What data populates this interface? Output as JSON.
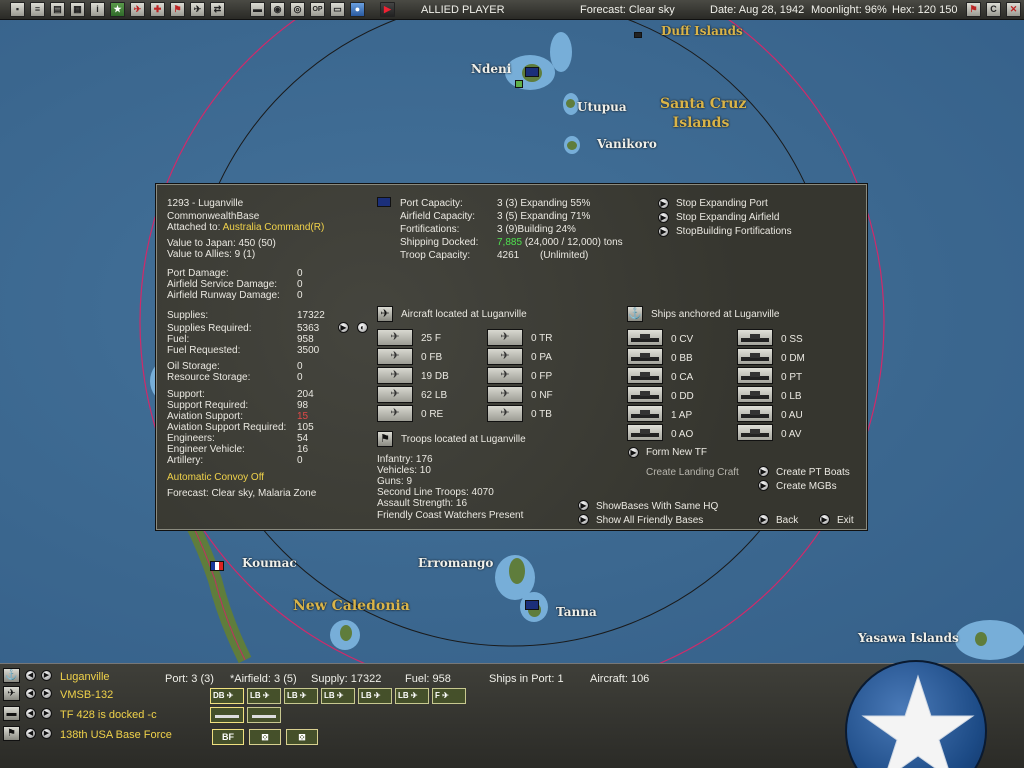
{
  "topbar": {
    "player": "ALLIED PLAYER",
    "forecast": "Forecast: Clear sky",
    "date": "Date: Aug 28, 1942",
    "moonlight": "Moonlight: 96%",
    "hex": "Hex: 120 150",
    "btn_c": "C",
    "btn_end_turn_icon": "play-icon"
  },
  "map": {
    "labels": {
      "duff": "Duff Islands",
      "ndeni": "Ndeni",
      "utupua": "Utupua",
      "santa_cruz": "Santa Cruz",
      "santa_cruz2": "Islands",
      "vanikoro": "Vanikoro",
      "koumac": "Koumac",
      "erromango": "Erromango",
      "new_caledonia": "New Caledonia",
      "tanna": "Tanna",
      "yasawa": "Yasawa Islands"
    },
    "colors": {
      "sea": "#3f6c93",
      "land": "#5f7d3c",
      "shallow": "#77aed8",
      "range_circle_inner": "#1a1a1a",
      "range_circle_outer": "#d02a6a"
    }
  },
  "base": {
    "title": "1293 - Luganville",
    "type": "CommonwealthBase",
    "attached_label": "Attached to:",
    "attached_value": "Australia Command(R)",
    "value_japan": "Value to Japan: 450 (50)",
    "value_allies": "Value to Allies: 9 (1)",
    "damage": [
      {
        "label": "Port Damage:",
        "value": "0"
      },
      {
        "label": "Airfield Service Damage:",
        "value": "0"
      },
      {
        "label": "Airfield Runway Damage:",
        "value": "0"
      }
    ],
    "supply": [
      {
        "label": "Supplies:",
        "value": "17322"
      },
      {
        "label": "Supplies Required:",
        "value": "5363"
      },
      {
        "label": "Fuel:",
        "value": "958"
      },
      {
        "label": "Fuel Requested:",
        "value": "3500"
      }
    ],
    "storage": [
      {
        "label": "Oil Storage:",
        "value": "0"
      },
      {
        "label": "Resource Storage:",
        "value": "0"
      }
    ],
    "support": [
      {
        "label": "Support:",
        "value": "204"
      },
      {
        "label": "Support Required:",
        "value": "98"
      },
      {
        "label": "Aviation Support:",
        "value": "15"
      },
      {
        "label": "Aviation Support Required:",
        "value": "105"
      },
      {
        "label": "Engineers:",
        "value": "54"
      },
      {
        "label": "Engineer Vehicle:",
        "value": "16"
      },
      {
        "label": "Artillery:",
        "value": "0"
      }
    ],
    "convoy": "Automatic Convoy Off",
    "forecast": "Forecast: Clear sky, Malaria Zone"
  },
  "capacity": [
    {
      "label": "Port Capacity:",
      "value": "3 (3) Expanding 55%"
    },
    {
      "label": "Airfield Capacity:",
      "value": "3 (5) Expanding 71%"
    },
    {
      "label": "Fortifications:",
      "value": "3 (9)Building 24%"
    }
  ],
  "shipping": {
    "label": "Shipping Docked:",
    "green": "7,885",
    "rest": "(24,000 / 12,000) tons"
  },
  "troop_capacity": {
    "label": "Troop Capacity:",
    "value": "4261",
    "extra": "(Unlimited)"
  },
  "actions": {
    "stop_port": "Stop Expanding Port",
    "stop_airfield": "Stop Expanding Airfield",
    "stop_forts": "StopBuilding Fortifications"
  },
  "aircraft": {
    "header": "Aircraft located at Luganville",
    "left": [
      "25 F",
      "0 FB",
      "19 DB",
      "62 LB",
      "0 RE"
    ],
    "right": [
      "0 TR",
      "0 PA",
      "0 FP",
      "0 NF",
      "0 TB"
    ]
  },
  "ships": {
    "header": "Ships anchored at Luganville",
    "left": [
      "0 CV",
      "0 BB",
      "0 CA",
      "0 DD",
      "1 AP",
      "0 AO"
    ],
    "right": [
      "0 SS",
      "0 DM",
      "0 PT",
      "0 LB",
      "0 AU",
      "0 AV"
    ],
    "form_tf": "Form New TF",
    "landing_craft": "Create Landing Craft",
    "pt_boats": "Create PT Boats",
    "mgbs": "Create MGBs"
  },
  "troops": {
    "header": "Troops located at Luganville",
    "lines": [
      "Infantry: 176",
      "Vehicles: 10",
      "Guns: 9",
      "Second Line Troops: 4070",
      "Assault Strength: 16",
      "Friendly Coast Watchers Present"
    ]
  },
  "footer_buttons": {
    "show_same_hq": "ShowBases With Same HQ",
    "show_all": "Show All Friendly Bases",
    "back": "Back",
    "exit": "Exit"
  },
  "bottom": {
    "rows": [
      "Luganville",
      "VMSB-132",
      "TF 428 is docked -c",
      "138th USA Base Force"
    ],
    "port": "Port: 3 (3)",
    "airfield": "*Airfield: 3 (5)",
    "supply": "Supply: 17322",
    "fuel": "Fuel: 958",
    "ships_in_port": "Ships in Port: 1",
    "aircraft": "Aircraft: 106",
    "air_chips": [
      "DB",
      "LB",
      "LB",
      "LB",
      "LB",
      "LB",
      "F"
    ],
    "unit_chips": [
      "BF"
    ]
  }
}
